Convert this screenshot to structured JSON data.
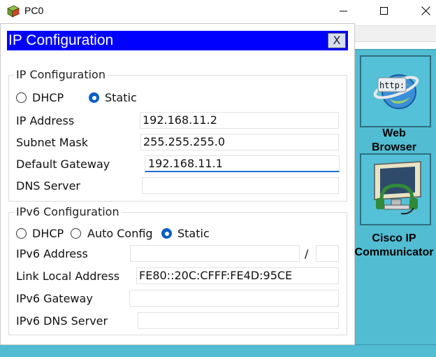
{
  "window": {
    "title": "PC0",
    "icon": "packet-tracer-pc-icon",
    "minimize_icon": "minimize-icon",
    "maximize_icon": "maximize-icon",
    "close_icon": "close-icon"
  },
  "dialog": {
    "title": "IP Configuration",
    "close_label": "X"
  },
  "ipv4": {
    "group_label": "IP Configuration",
    "dhcp_label": "DHCP",
    "static_label": "Static",
    "selected_mode": "Static",
    "ip_address_label": "IP Address",
    "ip_address_value": "192.168.11.2",
    "subnet_mask_label": "Subnet Mask",
    "subnet_mask_value": "255.255.255.0",
    "default_gateway_label": "Default Gateway",
    "default_gateway_value": "192.168.11.1",
    "dns_server_label": "DNS Server",
    "dns_server_value": ""
  },
  "ipv6": {
    "group_label": "IPv6 Configuration",
    "dhcp_label": "DHCP",
    "auto_config_label": "Auto Config",
    "static_label": "Static",
    "selected_mode": "Static",
    "address_label": "IPv6 Address",
    "address_value": "",
    "prefix_separator": "/",
    "prefix_value": "",
    "link_local_label": "Link Local Address",
    "link_local_value": "FE80::20C:CFFF:FE4D:95CE",
    "gateway_label": "IPv6 Gateway",
    "gateway_value": "",
    "dns_server_label": "IPv6 DNS Server",
    "dns_server_value": ""
  },
  "desktop_apps": [
    {
      "name": "Web Browser",
      "line1": "Web",
      "line2": "Browser",
      "icon": "web-browser-icon",
      "badge": "http:"
    },
    {
      "name": "Cisco IP Communicator",
      "line1": "Cisco IP",
      "line2": "Communicator",
      "icon": "cisco-ip-communicator-icon"
    }
  ],
  "colors": {
    "dialog_title_bg": "#0000ff",
    "desktop_bg": "#51bcd2",
    "radio_selected": "#0a5ec8",
    "focus_underline": "#1a6fd0"
  }
}
